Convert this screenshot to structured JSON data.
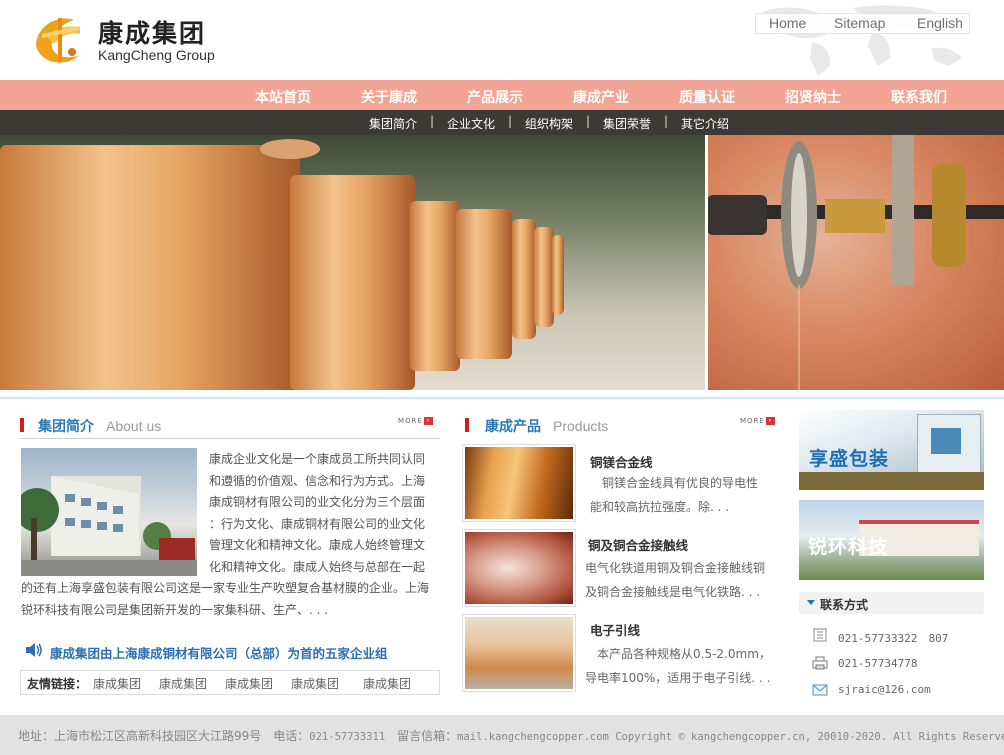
{
  "header": {
    "logo_cn": "康成集团",
    "logo_en": "KangCheng Group",
    "top_links": [
      "Home",
      "Sitemap",
      "English"
    ]
  },
  "nav": {
    "items": [
      "本站首页",
      "关于康成",
      "产品展示",
      "康成产业",
      "质量认证",
      "招贤纳士",
      "联系我们"
    ]
  },
  "subnav": {
    "items": [
      "集团简介",
      "企业文化",
      "组织构架",
      "集团荣誉",
      "其它介绍"
    ],
    "separator": "|"
  },
  "about": {
    "title_cn": "集团简介",
    "title_en": "About us",
    "more": "MORE",
    "lines_right": [
      "康成企业文化是一个康成员工所共同认同",
      "和遵循的价值观、信念和行为方式。上海",
      "康成铜材有限公司的业文化分为三个层面",
      "：行为文化、康成铜材有限公司的业文化",
      "管理文化和精神文化。康成人始终管理文",
      "化和精神文化。康成人始终与总部在一起"
    ],
    "lines_full": [
      "的还有上海享盛包装有限公司这是一家专业生产吹塑复合基材膜的企业。上海",
      "锐环科技有限公司是集团新开发的一家集科研、生产、. . ."
    ]
  },
  "notice": "康成集团由上海康成铜材有限公司（总部）为首的五家企业组",
  "friend_links": {
    "label": "友情链接：",
    "items": [
      "康成集团",
      "康成集团",
      "康成集团",
      "康成集团",
      "康成集团"
    ]
  },
  "products": {
    "title_cn": "康成产品",
    "title_en": "Products",
    "more": "MORE",
    "items": [
      {
        "name": "铜镁合金线",
        "desc": [
          "　铜镁合金线具有优良的导电性",
          "能和较高抗拉强度。除. . ."
        ]
      },
      {
        "name": "铜及铜合金接触线",
        "desc": [
          "电气化铁道用铜及铜合金接触线铜",
          "及铜合金接触线是电气化铁路. . ."
        ]
      },
      {
        "name": "电子引线",
        "desc": [
          "　本产品各种规格从0.5-2.0mm，",
          "导电率100%，适用于电子引线. . ."
        ]
      }
    ]
  },
  "ads": [
    {
      "label": "享盛包装"
    },
    {
      "label": "锐环科技"
    }
  ],
  "contact": {
    "title": "联系方式",
    "phone": "021-57733322　807",
    "fax": "021-57734778",
    "email": "sjraic@126.com"
  },
  "footer": {
    "address": "地址：上海市松江区高新科技园区大江路99号　电话：",
    "phone": "021-57733311",
    "mail_label": "　留言信箱：",
    "mail_and_copy": "mail.kangchengcopper.com Copyright © kangchengcopper.cn, 20010-2020. All Rights Reserved"
  },
  "colors": {
    "nav_bg": "#f1a493",
    "subnav_bg": "#3d3a36",
    "accent_blue": "#2b7ab6",
    "title_marker": "#d21e1e"
  }
}
